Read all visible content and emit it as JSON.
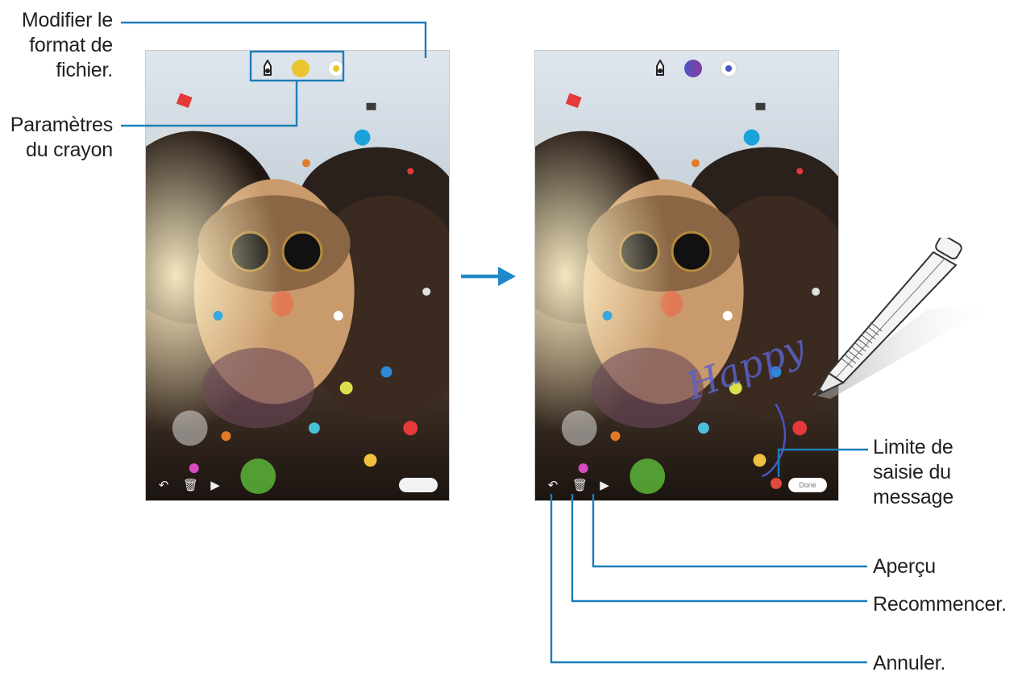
{
  "callouts": {
    "file_format_lines": [
      "Modifier le",
      "format de",
      "fichier."
    ],
    "pen_settings_lines": [
      "Paramètres",
      "du crayon"
    ],
    "message_limit_lines": [
      "Limite de",
      "saisie du",
      "message"
    ],
    "preview": "Aperçu",
    "restart": "Recommencer.",
    "undo": "Annuler."
  },
  "left_screen": {
    "pen_icon": "pen-type-icon",
    "pen_color": "#e8c531",
    "effect_icon": "pen-effect-icon"
  },
  "right_screen": {
    "pen_icon": "pen-type-icon",
    "pen_color": "#4a56c4",
    "effect_icon": "pen-effect-icon",
    "handwritten_text": "Happy",
    "done_label": "Done"
  },
  "colors": {
    "callout_line": "#1e7db8",
    "arrow": "#1e88c8"
  }
}
